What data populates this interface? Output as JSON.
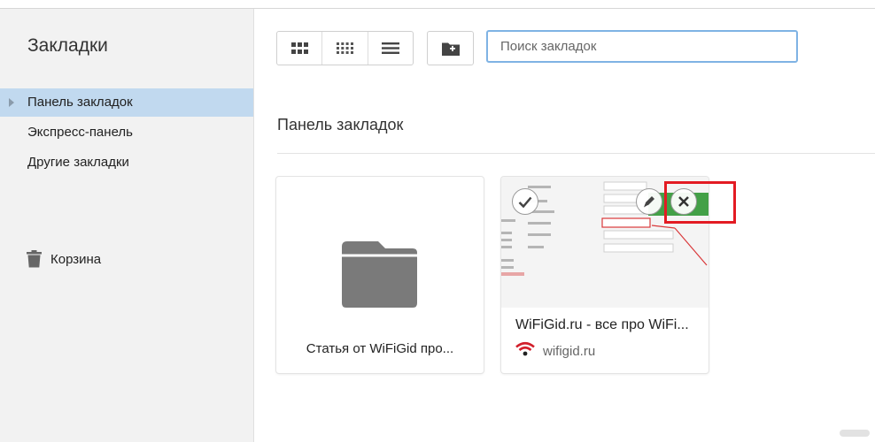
{
  "sidebar": {
    "title": "Закладки",
    "items": [
      {
        "label": "Панель закладок",
        "active": true
      },
      {
        "label": "Экспресс-панель",
        "active": false
      },
      {
        "label": "Другие закладки",
        "active": false
      }
    ],
    "trash_label": "Корзина"
  },
  "toolbar": {
    "views": [
      "large-grid-icon",
      "small-grid-icon",
      "list-icon"
    ],
    "new_folder_icon": "new-folder-icon",
    "search_placeholder": "Поиск закладок"
  },
  "main": {
    "section_title": "Панель закладок",
    "cards": [
      {
        "type": "folder",
        "label": "Статья от WiFiGid про..."
      },
      {
        "type": "bookmark",
        "title": "WiFiGid.ru - все про WiFi...",
        "domain": "wifigid.ru"
      }
    ]
  },
  "colors": {
    "sidebar_bg": "#f2f2f2",
    "active_item_bg": "#c1d9ef",
    "search_border": "#7fb3e4",
    "highlight_red": "#e31b23",
    "folder_gray": "#7a7a7a"
  }
}
